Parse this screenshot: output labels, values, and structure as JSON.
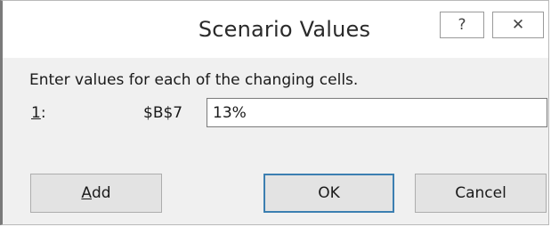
{
  "window": {
    "title": "Scenario Values",
    "help_glyph": "?",
    "close_glyph": "✕"
  },
  "dialog": {
    "prompt": "Enter values for each of the changing cells.",
    "rows": [
      {
        "index_label": "1",
        "index_suffix": ":",
        "cell_ref": "$B$7",
        "value": "13%"
      }
    ]
  },
  "buttons": {
    "add_accel": "A",
    "add_rest": "dd",
    "ok": "OK",
    "cancel": "Cancel"
  }
}
